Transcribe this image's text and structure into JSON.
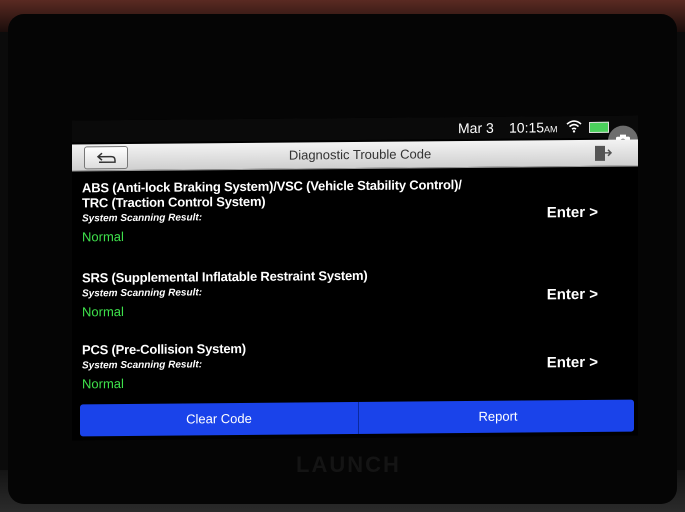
{
  "status_bar": {
    "date": "Mar 3",
    "time": "10:15",
    "ampm": "AM"
  },
  "header": {
    "title": "Diagnostic Trouble Code"
  },
  "systems": [
    {
      "name_line1": "ABS (Anti-lock Braking System)/VSC (Vehicle Stability Control)/",
      "name_line2": "TRC (Traction Control System)",
      "scan_label": "System Scanning Result:",
      "status": "Normal",
      "enter_label": "Enter >"
    },
    {
      "name_line1": "SRS (Supplemental Inflatable Restraint System)",
      "scan_label": "System Scanning Result:",
      "status": "Normal",
      "enter_label": "Enter >"
    },
    {
      "name_line1": "PCS (Pre-Collision System)",
      "scan_label": "System Scanning Result:",
      "status": "Normal",
      "enter_label": "Enter >"
    }
  ],
  "footer": {
    "clear_code_label": "Clear Code",
    "report_label": "Report"
  },
  "device": {
    "brand": "LAUNCH"
  },
  "colors": {
    "status_ok": "#3ee04b",
    "action_bar": "#1a43ea",
    "battery": "#4bd15c"
  },
  "icons": {
    "back": "back-arrow-icon",
    "exit": "exit-icon",
    "wifi": "wifi-icon",
    "battery": "battery-icon",
    "camera": "camera-icon"
  }
}
